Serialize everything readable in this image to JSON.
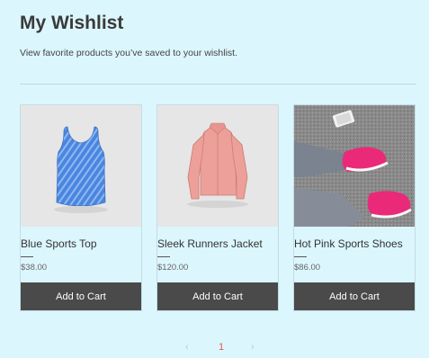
{
  "header": {
    "title": "My Wishlist",
    "subtitle": "View favorite products you’ve saved to your wishlist."
  },
  "products": [
    {
      "name": "Blue Sports Top",
      "price": "$38.00",
      "button": "Add to Cart",
      "image": "blue-tank-top-image"
    },
    {
      "name": "Sleek Runners Jacket",
      "price": "$120.00",
      "button": "Add to Cart",
      "image": "pink-jacket-image"
    },
    {
      "name": "Hot Pink Sports Shoes",
      "price": "$86.00",
      "button": "Add to Cart",
      "image": "pink-sneakers-image"
    }
  ],
  "pagination": {
    "prev": "‹",
    "current": "1",
    "next": "›"
  },
  "colors": {
    "background": "#dcf6fd",
    "button": "#4a4a4a",
    "active_page": "#e05a4a"
  }
}
